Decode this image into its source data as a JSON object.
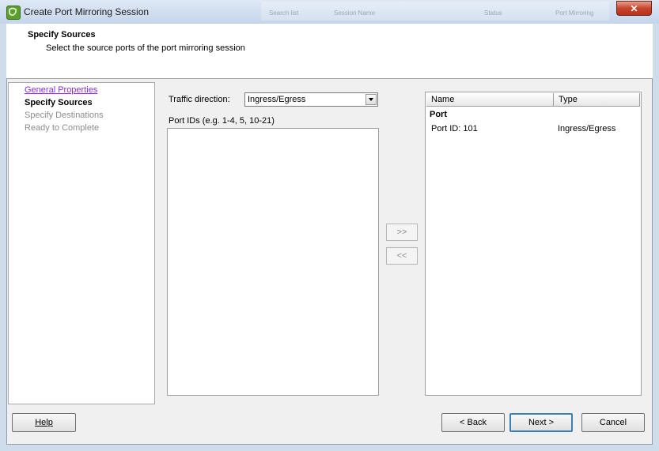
{
  "window": {
    "title": "Create Port Mirroring Session",
    "close_label": "✕",
    "background_texts": [
      "Search list",
      "Session Name",
      "Status",
      "Port Mirroring"
    ]
  },
  "header": {
    "title": "Specify Sources",
    "subtitle": "Select the source ports of the port mirroring session"
  },
  "nav": {
    "items": [
      {
        "label": "General Properties",
        "state": "link"
      },
      {
        "label": "Specify Sources",
        "state": "current"
      },
      {
        "label": "Specify Destinations",
        "state": "disabled"
      },
      {
        "label": "Ready to Complete",
        "state": "disabled"
      }
    ]
  },
  "form": {
    "traffic_label": "Traffic direction:",
    "traffic_value": "Ingress/Egress",
    "port_ids_label": "Port IDs (e.g. 1-4, 5, 10-21)",
    "port_ids_value": ""
  },
  "transfer": {
    "add_label": ">>",
    "remove_label": "<<"
  },
  "table": {
    "columns": [
      "Name",
      "Type"
    ],
    "group": "Port",
    "rows": [
      {
        "name": "Port ID: 101",
        "type": "Ingress/Egress"
      }
    ]
  },
  "footer": {
    "help_label": "Help",
    "back_label": "Back",
    "next_label": "Next",
    "cancel_label": "Cancel"
  },
  "colors": {
    "frame": "#cfdce9",
    "close_button": "#c7442d",
    "link_visited": "#8a2be2",
    "default_button_border": "#3c7fb1"
  }
}
